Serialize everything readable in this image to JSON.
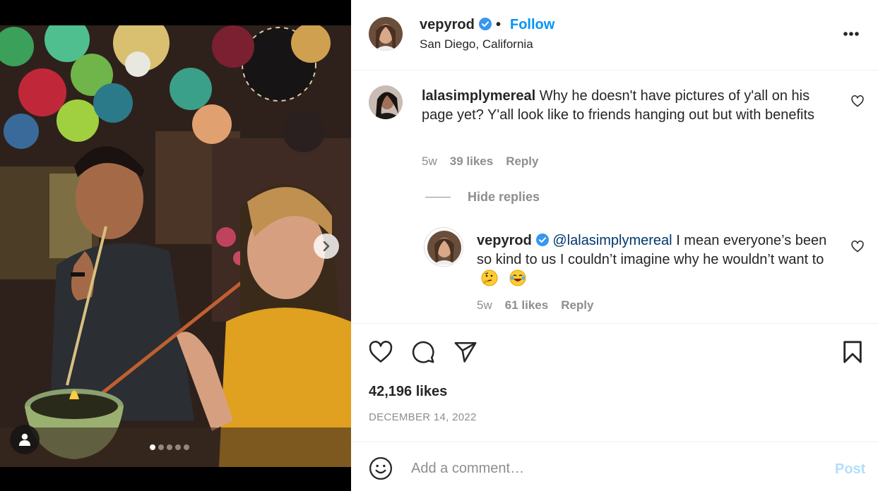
{
  "post": {
    "author": "vepyrod",
    "separator": "•",
    "follow_label": "Follow",
    "location": "San Diego, California",
    "likes": "42,196 likes",
    "date": "DECEMBER 14, 2022",
    "carousel": {
      "total": 5,
      "active_index": 0
    }
  },
  "comments": [
    {
      "username": "lalasimplymereal",
      "text": "Why he doesn't have pictures of y'all on his page yet? Y'all look like to friends hanging out but with benefits",
      "age": "5w",
      "likes": "39 likes",
      "reply_label": "Reply"
    }
  ],
  "hide_replies_label": "Hide replies",
  "reply": {
    "username": "vepyrod",
    "mention": "@lalasimplymereal",
    "text": "I mean everyone’s been so kind to us I couldn’t imagine why he wouldn’t want to",
    "emojis": [
      "thinking-face",
      "laughing-tears-face"
    ],
    "age": "5w",
    "likes": "61 likes",
    "reply_label": "Reply"
  },
  "add_comment": {
    "placeholder": "Add a comment…",
    "post_label": "Post"
  },
  "colors": {
    "accent": "#0095f6",
    "verified": "#3897f0",
    "mention": "#00376b",
    "muted": "#8e8e8e",
    "post_disabled": "#b2dffc"
  }
}
